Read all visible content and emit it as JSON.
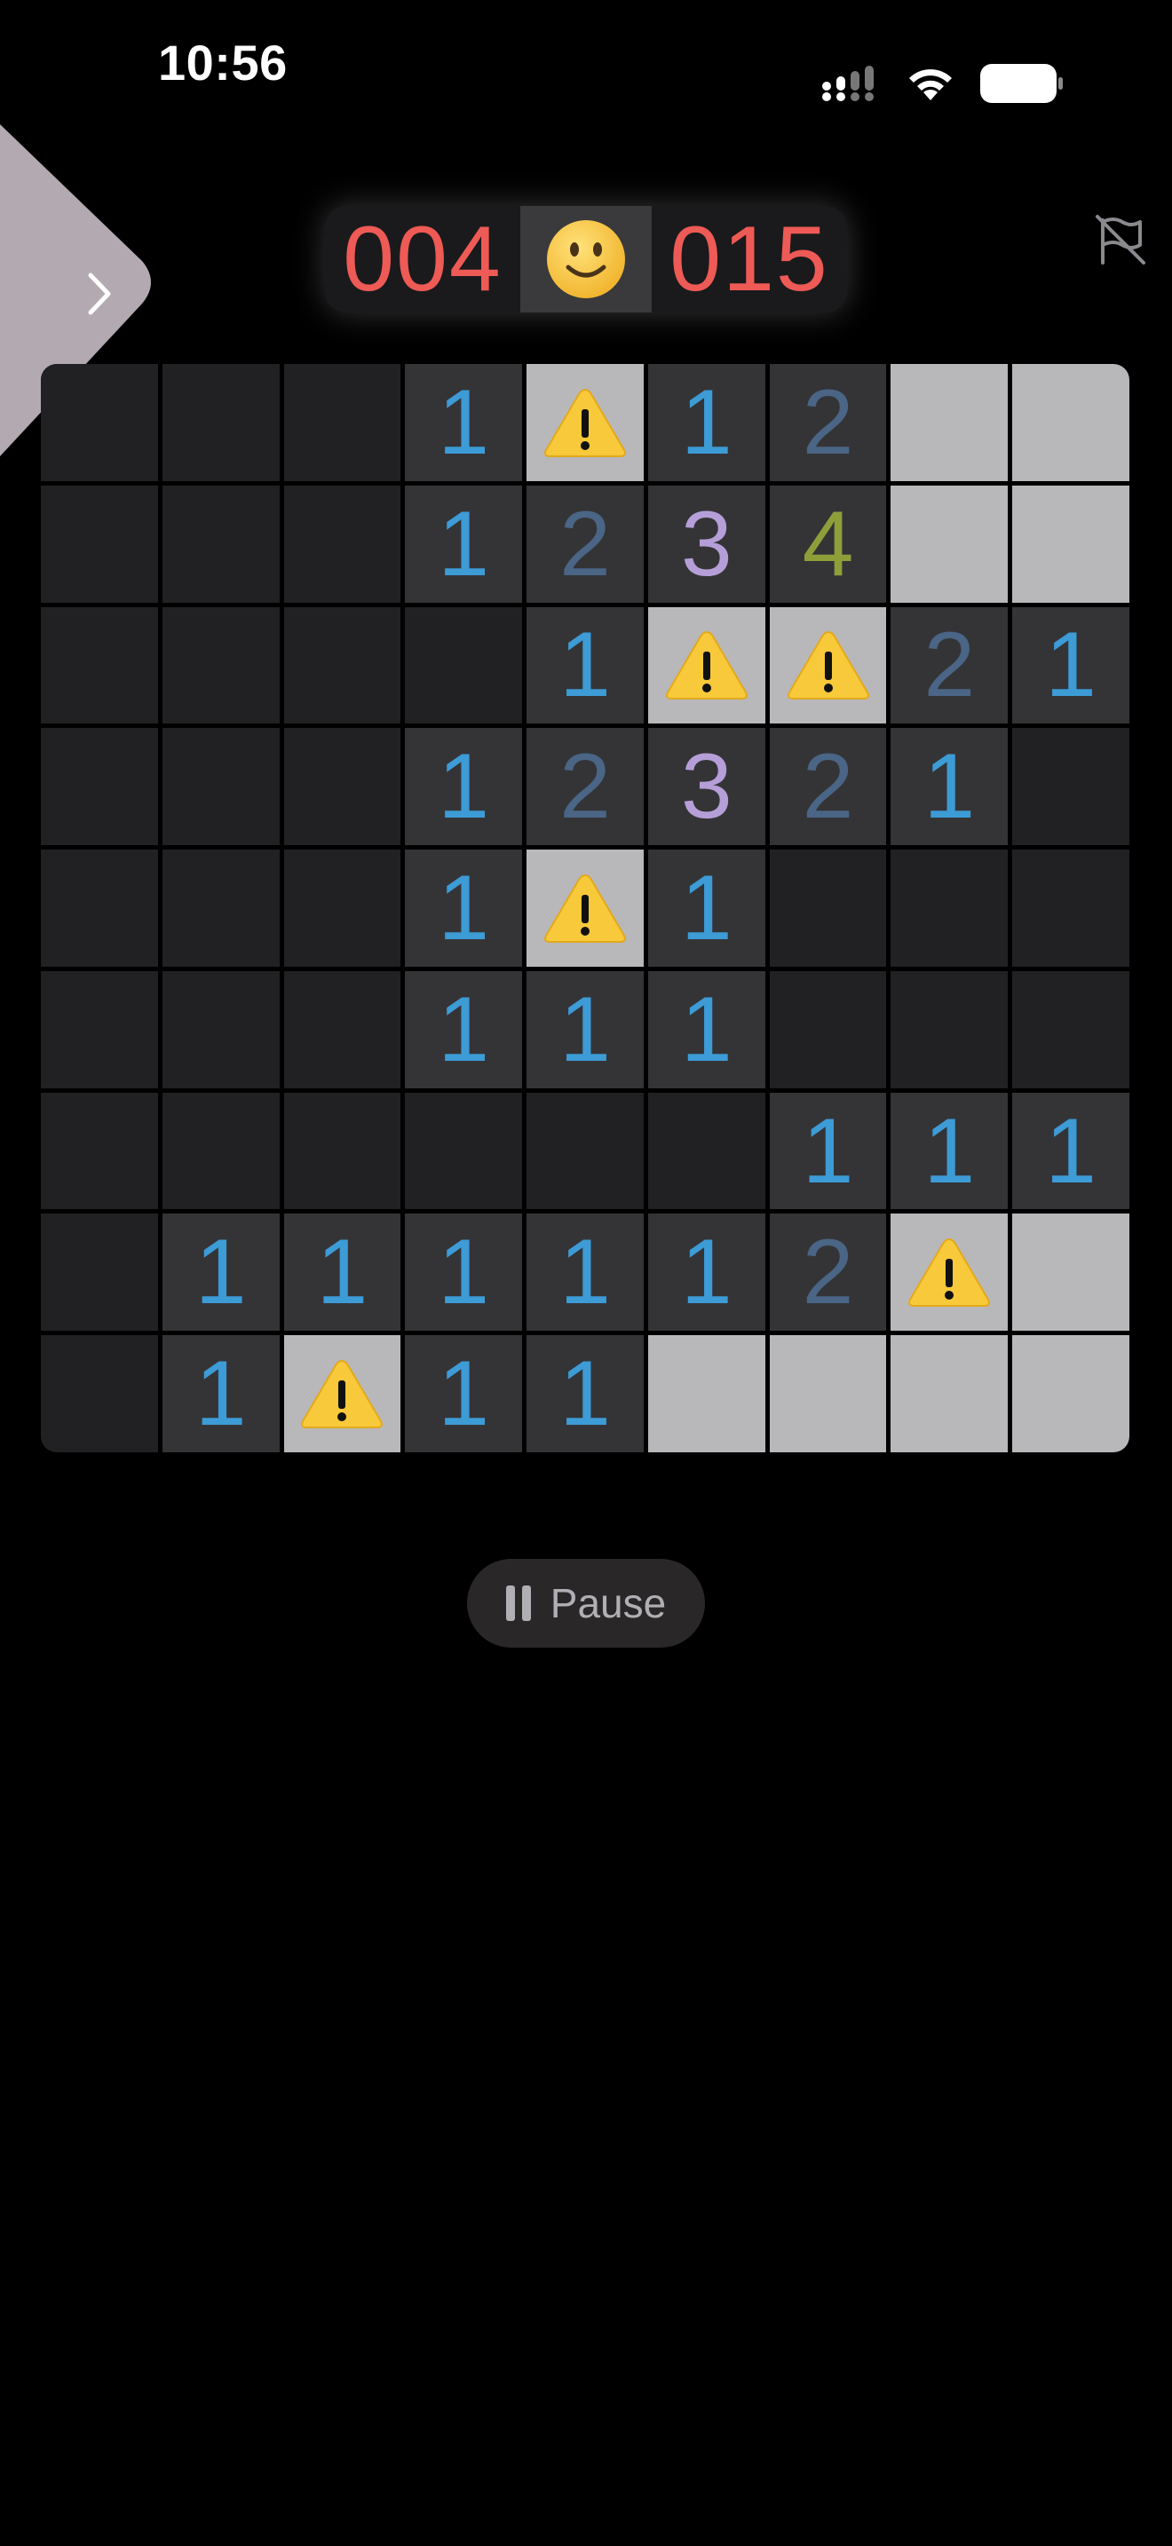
{
  "status_bar": {
    "time": "10:56",
    "icons": [
      "cellular-signal-icon",
      "wifi-icon",
      "battery-icon"
    ]
  },
  "drawer": {
    "icon": "chevron-right-icon"
  },
  "flag_toggle": {
    "icon": "flag-slash-icon"
  },
  "scoreboard": {
    "mines_remaining": "004",
    "face": "🙂",
    "timer": "015"
  },
  "board": {
    "rows": 9,
    "cols": 9,
    "legend": {
      "e": "revealed-empty",
      "h": "unrevealed",
      "f": "flagged-warning",
      "1-8": "revealed-number"
    },
    "cells": [
      [
        "e",
        "e",
        "e",
        "1",
        "f",
        "1",
        "2",
        "h",
        "h"
      ],
      [
        "e",
        "e",
        "e",
        "1",
        "2",
        "3",
        "4",
        "h",
        "h"
      ],
      [
        "e",
        "e",
        "e",
        "e",
        "1",
        "f",
        "f",
        "2",
        "1"
      ],
      [
        "e",
        "e",
        "e",
        "1",
        "2",
        "3",
        "2",
        "1",
        "e"
      ],
      [
        "e",
        "e",
        "e",
        "1",
        "f",
        "1",
        "e",
        "e",
        "e"
      ],
      [
        "e",
        "e",
        "e",
        "1",
        "1",
        "1",
        "e",
        "e",
        "e"
      ],
      [
        "e",
        "e",
        "e",
        "e",
        "e",
        "e",
        "1",
        "1",
        "1"
      ],
      [
        "e",
        "1",
        "1",
        "1",
        "1",
        "1",
        "2",
        "f",
        "h"
      ],
      [
        "e",
        "1",
        "f",
        "1",
        "1",
        "h",
        "h",
        "h",
        "h"
      ]
    ],
    "number_colors": {
      "1": "#3d9bd6",
      "2": "#4a6585",
      "3": "#b69fd8",
      "4": "#8e9f3a"
    },
    "flag_icon": "warning-triangle-icon"
  },
  "pause": {
    "label": "Pause",
    "icon": "pause-icon"
  }
}
